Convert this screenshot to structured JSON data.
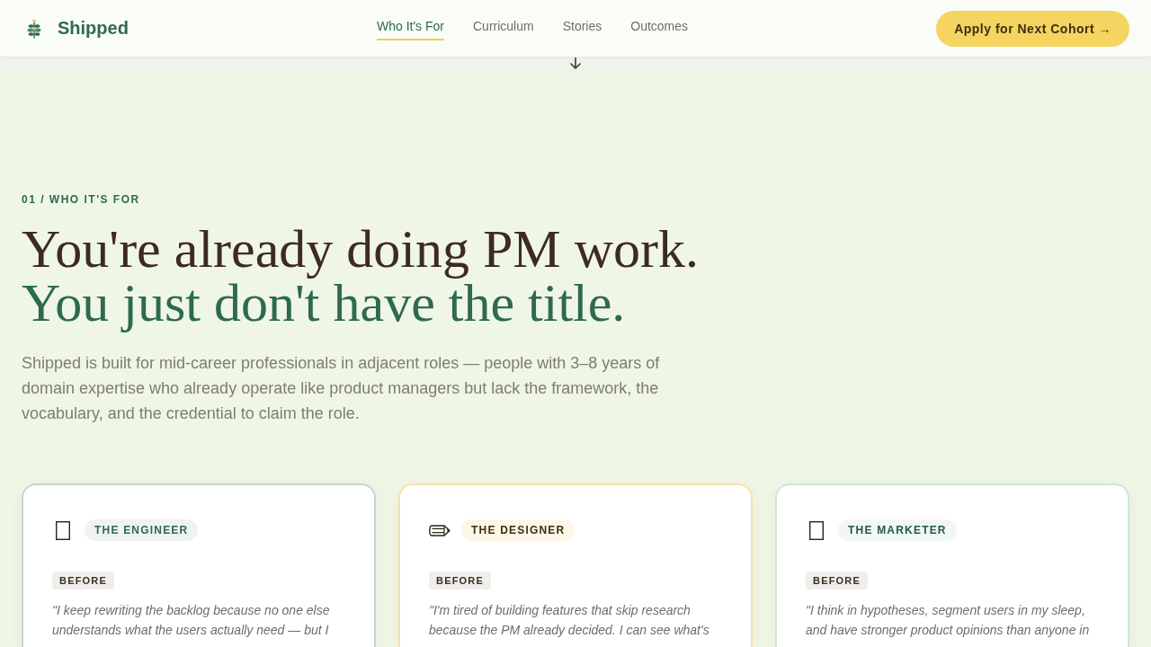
{
  "header": {
    "brand": "Shipped",
    "nav": [
      {
        "label": "Who It's For",
        "selected": true
      },
      {
        "label": "Curriculum",
        "selected": false
      },
      {
        "label": "Stories",
        "selected": false
      },
      {
        "label": "Outcomes",
        "selected": false
      }
    ],
    "cta": "Apply for Next Cohort →"
  },
  "hero": {
    "eyebrow": "01 / WHO IT'S FOR",
    "heading_lines": [
      {
        "text": "You're already doing PM work.",
        "accent": false
      },
      {
        "text": "You just don't have the title.",
        "accent": true
      }
    ],
    "intro": "Shipped is built for mid-career professionals in adjacent roles — people with 3–8 years of domain expertise who already operate like product managers but lack the framework, the vocabulary, and the credential to claim the role."
  },
  "cards": [
    {
      "kind": "engineer",
      "title": "THE ENGINEER",
      "color": "#c6d5cd",
      "badge": "BEFORE",
      "quote": "\"I keep rewriting the backlog because no one else understands what the users actually need — but I"
    },
    {
      "kind": "designer",
      "title": "THE DESIGNER",
      "color": "#f5e3a6",
      "badge": "BEFORE",
      "quote": "\"I'm tired of building features that skip research because the PM already decided. I can see what's"
    },
    {
      "kind": "marketer",
      "title": "THE MARKETER",
      "color": "#cde6d8",
      "badge": "BEFORE",
      "quote": "\"I think in hypotheses, segment users in my sleep, and have stronger product opinions than anyone in"
    }
  ]
}
